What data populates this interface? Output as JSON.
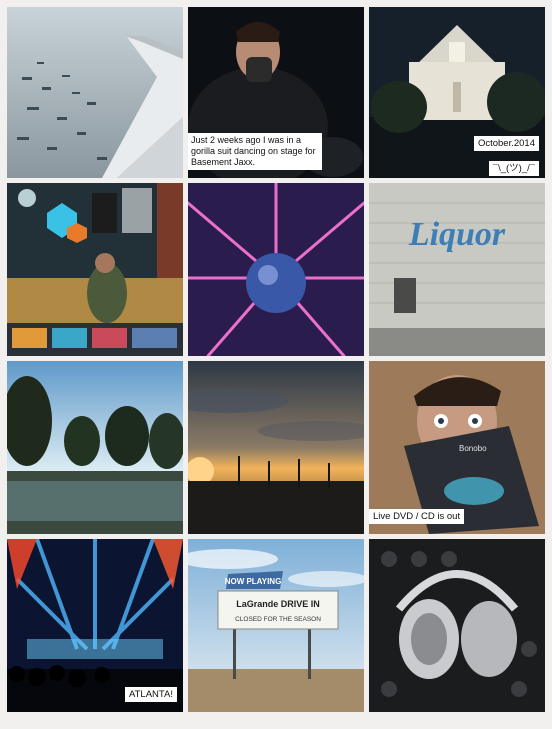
{
  "feed": {
    "tiles": [
      {
        "name": "plane-wing-photo",
        "caption": ""
      },
      {
        "name": "gorilla-suit-photo",
        "caption": "Just 2 weeks ago I was in a gorilla suit dancing on stage for Basement Jaxx."
      },
      {
        "name": "cathedral-night-photo",
        "caption": "October.2014",
        "caption2": "¯\\_(ツ)_/¯"
      },
      {
        "name": "merch-table-photo",
        "caption": ""
      },
      {
        "name": "disco-ball-photo",
        "caption": ""
      },
      {
        "name": "liquor-sign-photo",
        "caption": ""
      },
      {
        "name": "swamp-photo",
        "caption": ""
      },
      {
        "name": "sunset-palms-photo",
        "caption": ""
      },
      {
        "name": "dvd-selfie-photo",
        "caption": "Live DVD / CD is out"
      },
      {
        "name": "concert-stage-photo",
        "caption": "ATLANTA!"
      },
      {
        "name": "drive-in-sign-photo",
        "caption": ""
      },
      {
        "name": "dj-headphones-photo",
        "caption": ""
      }
    ],
    "sign_text": {
      "liquor": "Liquor",
      "drive_in_top": "NOW PLAYING",
      "drive_in_name": "LaGrande DRIVE IN",
      "drive_in_sub": "CLOSED FOR THE SEASON",
      "dvd_label": "Bonobo"
    }
  }
}
